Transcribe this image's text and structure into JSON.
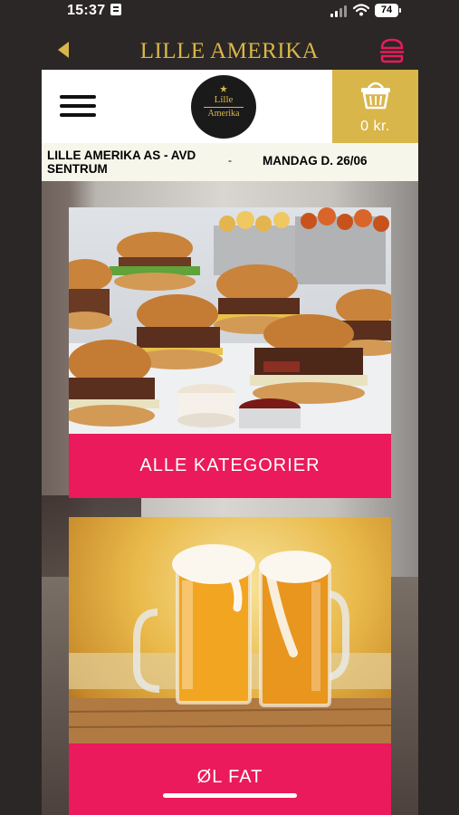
{
  "status_bar": {
    "time": "15:37",
    "battery": "74"
  },
  "header": {
    "title": "LILLE AMERIKA",
    "accent_color": "#d9b64a",
    "icon_color": "#ea1a5c",
    "back_icon": "chevron-left-icon",
    "right_icon": "burger-icon"
  },
  "top_bar": {
    "menu_icon": "hamburger-menu-icon",
    "logo": {
      "line1": "Lille",
      "line2": "Amerika"
    },
    "cart": {
      "icon": "basket-icon",
      "total": "0 kr."
    }
  },
  "info_bar": {
    "store_name": "LILLE AMERIKA AS - AVD SENTRUM",
    "separator": "-",
    "date": "MANDAG D. 26/06"
  },
  "categories": [
    {
      "label": "ALLE KATEGORIER",
      "image": "burgers-and-fries"
    },
    {
      "label": "ØL FAT",
      "image": "beer-mugs"
    }
  ],
  "colors": {
    "background": "#2b2726",
    "category_label": "#ea1a5c",
    "cart_background": "#d9b64a",
    "info_bar": "#f6f6ea"
  }
}
